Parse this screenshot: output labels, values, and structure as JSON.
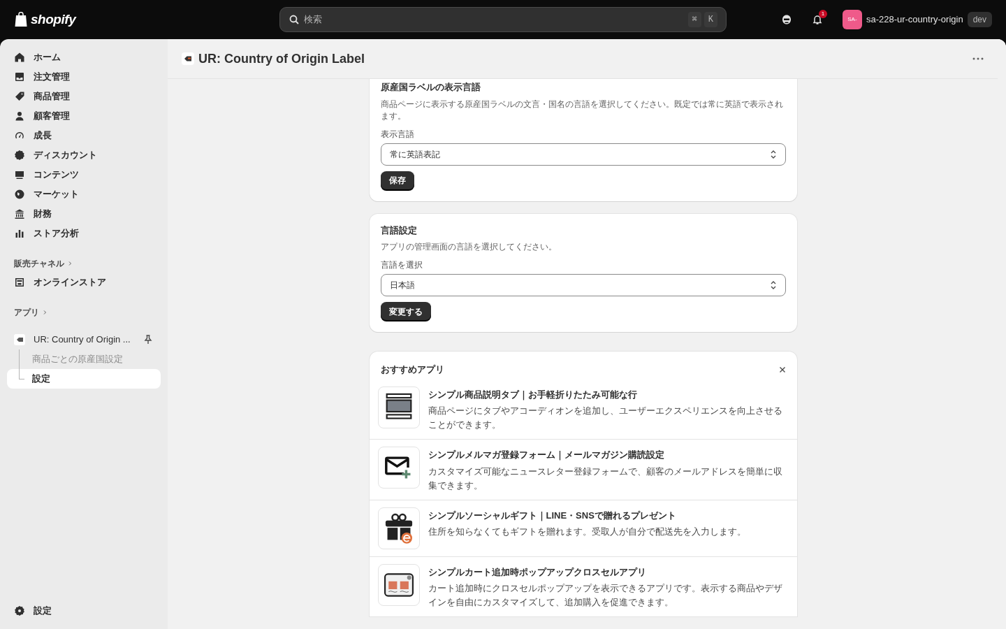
{
  "top_bar": {
    "logo": "shopify",
    "search": {
      "placeholder": "検索",
      "shortcut": [
        "⌘",
        "K"
      ]
    },
    "notification_count": "1",
    "store": {
      "avatar": "SA-",
      "name": "sa-228-ur-country-origin",
      "badge": "dev"
    }
  },
  "sidebar": {
    "items": [
      {
        "label": "ホーム",
        "selected": false
      },
      {
        "label": "注文管理",
        "selected": false
      },
      {
        "label": "商品管理",
        "selected": false
      },
      {
        "label": "顧客管理",
        "selected": false
      },
      {
        "label": "成長",
        "selected": false
      },
      {
        "label": "ディスカウント",
        "selected": false
      },
      {
        "label": "コンテンツ",
        "selected": false
      },
      {
        "label": "マーケット",
        "selected": false
      },
      {
        "label": "財務",
        "selected": false
      },
      {
        "label": "ストア分析",
        "selected": false
      }
    ],
    "sections": [
      {
        "title": "販売チャネル",
        "items": [
          {
            "label": "オンラインストア",
            "selected": false
          }
        ]
      },
      {
        "title": "アプリ",
        "items": [
          {
            "label": "UR: Country of Origin ...",
            "selected": false,
            "pinned": true,
            "children": [
              {
                "label": "商品ごとの原産国設定",
                "selected": false
              },
              {
                "label": "設定",
                "selected": true
              }
            ]
          }
        ]
      }
    ],
    "footer": {
      "label": "設定"
    }
  },
  "page": {
    "title": "UR: Country of Origin Label",
    "cards": [
      {
        "title": "原産国ラベルの表示言語",
        "description": "商品ページに表示する原産国ラベルの文言・国名の言語を選択してください。既定では常に英語で表示されます。",
        "field_label": "表示言語",
        "value": "常に英語表記",
        "button": "保存"
      },
      {
        "title": "言語設定",
        "description": "アプリの管理画面の言語を選択してください。",
        "field_label": "言語を選択",
        "value": "日本語",
        "button": "変更する"
      }
    ],
    "recommended": {
      "title": "おすすめアプリ",
      "apps": [
        {
          "kind": "tabs",
          "name": "シンプル商品説明タブ｜お手軽折りたたみ可能な行",
          "description": "商品ページにタブやアコーディオンを追加し、ユーザーエクスペリエンスを向上させることができます。"
        },
        {
          "kind": "mail",
          "name": "シンプルメルマガ登録フォーム｜メールマガジン購読設定",
          "description": "カスタマイズ可能なニュースレター登録フォームで、顧客のメールアドレスを簡単に収集できます。"
        },
        {
          "kind": "gift",
          "name": "シンプルソーシャルギフト｜LINE・SNSで贈れるプレゼント",
          "description": "住所を知らなくてもギフトを贈れます。受取人が自分で配送先を入力します。"
        },
        {
          "kind": "popup",
          "name": "シンプルカート追加時ポップアップクロスセルアプリ",
          "description": "カート追加時にクロスセルポップアップを表示できるアプリです。表示する商品やデザインを自由にカスタマイズして、追加購入を促進できます。"
        }
      ]
    }
  }
}
